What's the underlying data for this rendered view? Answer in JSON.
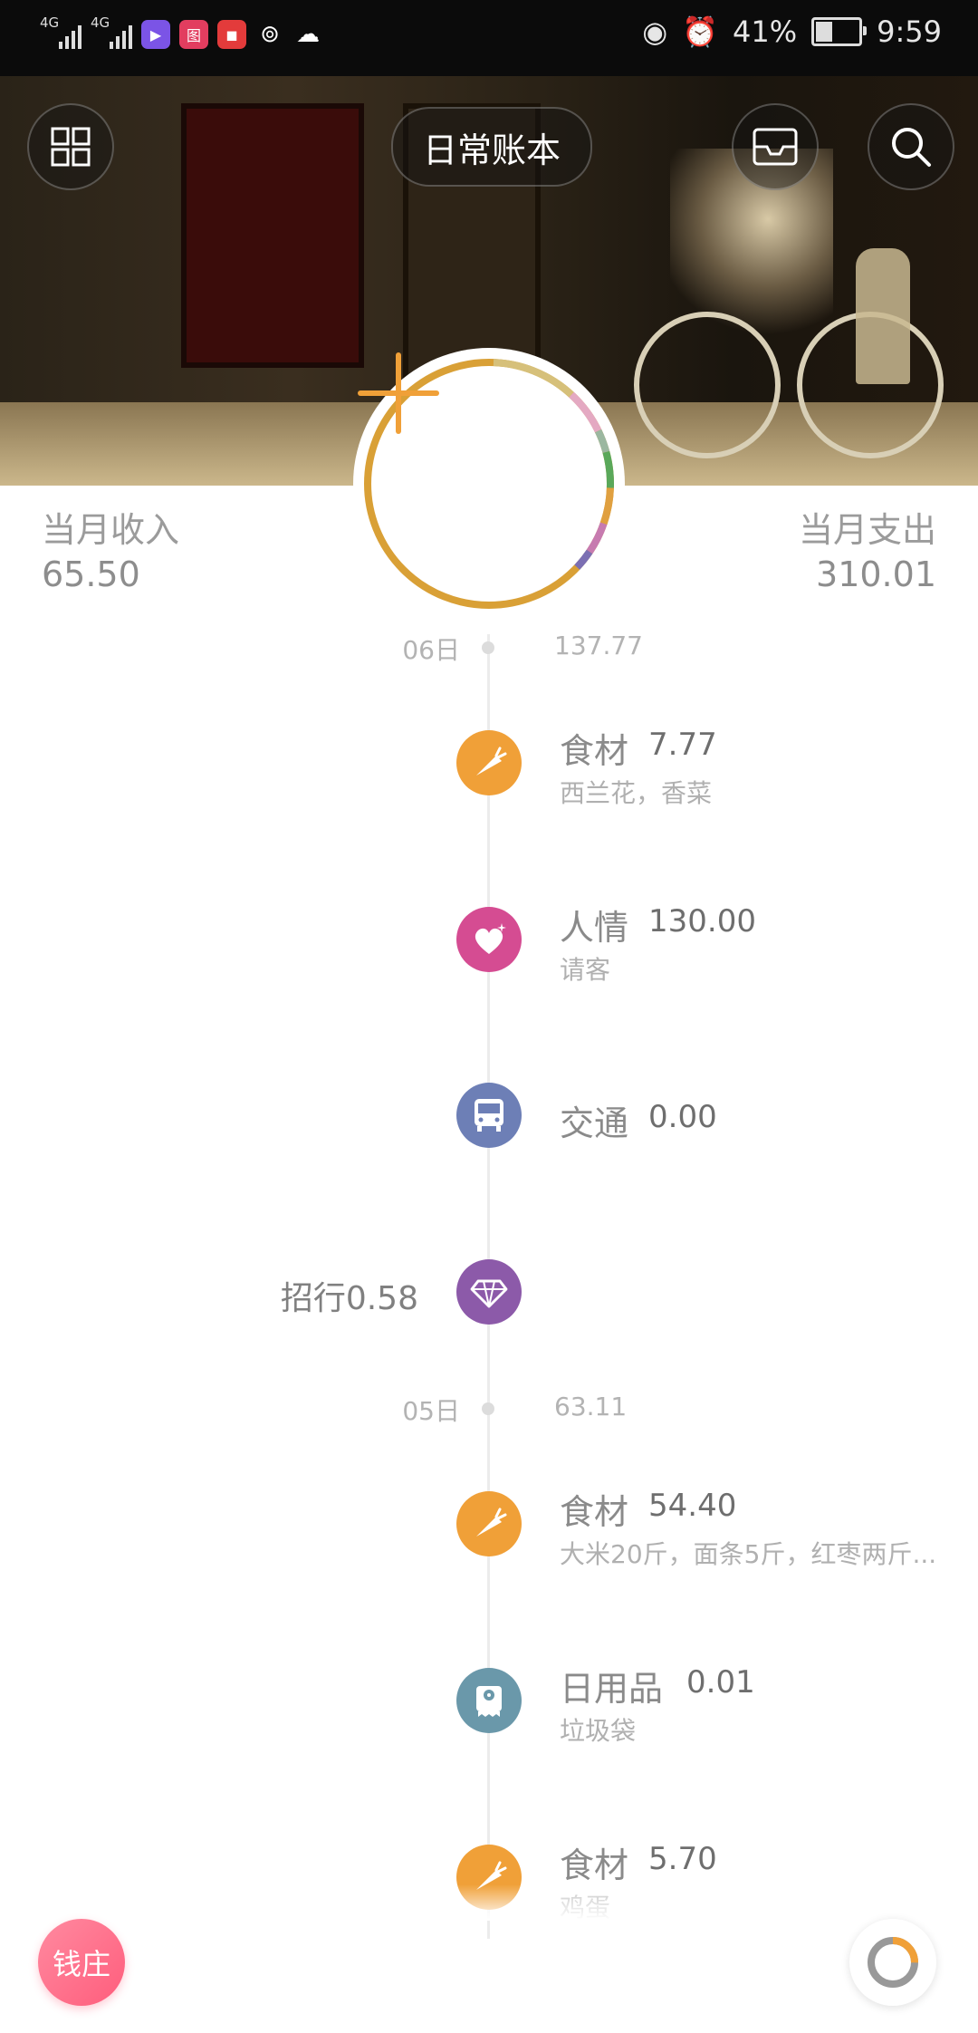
{
  "status_bar": {
    "signal1": "4G",
    "signal2": "4G",
    "app_icon_3": "图",
    "battery": "41%",
    "time": "9:59"
  },
  "header": {
    "book_name": "日常账本"
  },
  "summary": {
    "income_label": "当月收入",
    "income_value": "65.50",
    "expense_label": "当月支出",
    "expense_value": "310.01"
  },
  "timeline": [
    {
      "type": "date",
      "day": "06日",
      "total": "137.77"
    },
    {
      "type": "entry",
      "category": "食材",
      "amount": "7.77",
      "note": "西兰花，香菜",
      "icon": "carrot-icon",
      "color": "#f0a038"
    },
    {
      "type": "entry",
      "category": "人情",
      "amount": "130.00",
      "note": "请客",
      "icon": "heart-gift-icon",
      "color": "#d54c92"
    },
    {
      "type": "entry",
      "category": "交通",
      "amount": "0.00",
      "note": "",
      "icon": "bus-icon",
      "color": "#6d7fb6"
    },
    {
      "type": "income",
      "label": "招行0.58",
      "icon": "diamond-icon",
      "color": "#8c5aa9"
    },
    {
      "type": "date",
      "day": "05日",
      "total": "63.11"
    },
    {
      "type": "entry",
      "category": "食材",
      "amount": "54.40",
      "note": "大米20斤，面条5斤，红枣两斤...",
      "icon": "carrot-icon",
      "color": "#f0a038"
    },
    {
      "type": "entry",
      "category": "日用品",
      "amount": "0.01",
      "note": "垃圾袋",
      "icon": "tissue-roll-icon",
      "color": "#6a98aa"
    },
    {
      "type": "entry",
      "category": "食材",
      "amount": "5.70",
      "note": "鸡蛋",
      "icon": "carrot-icon",
      "color": "#f0a038"
    }
  ],
  "bottom": {
    "left_button": "钱庄"
  },
  "colors": {
    "accent_orange": "#f0a038",
    "donut_gold": "#d9a036"
  }
}
